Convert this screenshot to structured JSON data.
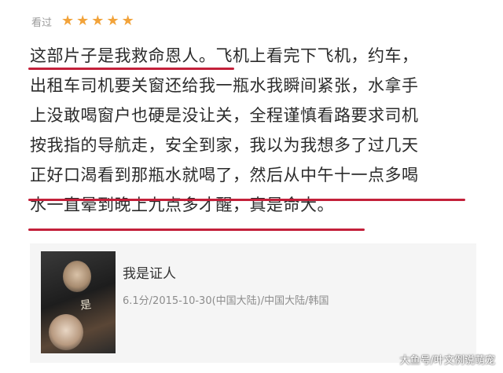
{
  "header": {
    "seen_label": "看过",
    "rating_stars": 5
  },
  "review": {
    "lines": [
      "这部片子是我救命恩人。飞机上看完下飞机，约车，",
      "出租车司机要关窗还给我一瓶水我瞬间紧张，水拿手",
      "上没敢喝窗户也硬是没让关，全程谨慎看路要求司机",
      "按我指的导航走，安全到家，我以为我想多了过几天",
      "正好口渴看到那瓶水就喝了，然后从中午十一点多喝",
      "水一直晕到晚上九点多才醒，真是命大。"
    ],
    "highlight_color": "#c3203a"
  },
  "movie": {
    "title": "我是证人",
    "meta": "6.1分/2015-10-30(中国大陆)/中国大陆/韩国",
    "poster_script": "是"
  },
  "watermark": "大鱼号/叶文例说萌宠"
}
